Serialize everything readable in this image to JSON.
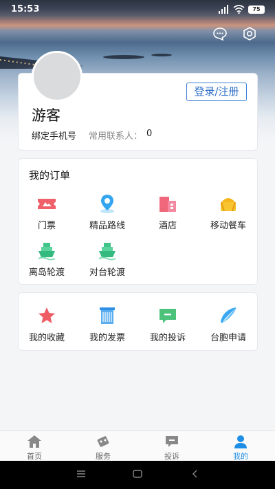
{
  "status": {
    "time": "15:53",
    "battery": "75"
  },
  "header": {
    "message_icon": "message-icon",
    "settings_icon": "settings-icon"
  },
  "profile": {
    "login_label": "登录/注册",
    "username": "游客",
    "bind_phone": "绑定手机号",
    "contacts_label": "常用联系人：",
    "contacts_count": "0"
  },
  "orders": {
    "title": "我的订单",
    "items": [
      {
        "label": "门票",
        "icon": "ticket-icon"
      },
      {
        "label": "精品路线",
        "icon": "route-pin-icon"
      },
      {
        "label": "酒店",
        "icon": "hotel-icon"
      },
      {
        "label": "移动餐车",
        "icon": "food-cart-icon"
      },
      {
        "label": "离岛轮渡",
        "icon": "ferry-icon"
      },
      {
        "label": "对台轮渡",
        "icon": "ferry-icon"
      }
    ]
  },
  "services": {
    "items": [
      {
        "label": "我的收藏",
        "icon": "star-icon"
      },
      {
        "label": "我的发票",
        "icon": "invoice-icon"
      },
      {
        "label": "我的投诉",
        "icon": "complaint-icon"
      },
      {
        "label": "台胞申请",
        "icon": "feather-icon"
      }
    ]
  },
  "tabbar": {
    "items": [
      {
        "label": "首页",
        "icon": "home-icon"
      },
      {
        "label": "服务",
        "icon": "service-icon"
      },
      {
        "label": "投诉",
        "icon": "complaint-tab-icon"
      },
      {
        "label": "我的",
        "icon": "profile-icon"
      }
    ],
    "active_color": "#1f8fe6"
  },
  "colors": {
    "accent": "#3b7fd6",
    "background": "#f4f5f7"
  }
}
